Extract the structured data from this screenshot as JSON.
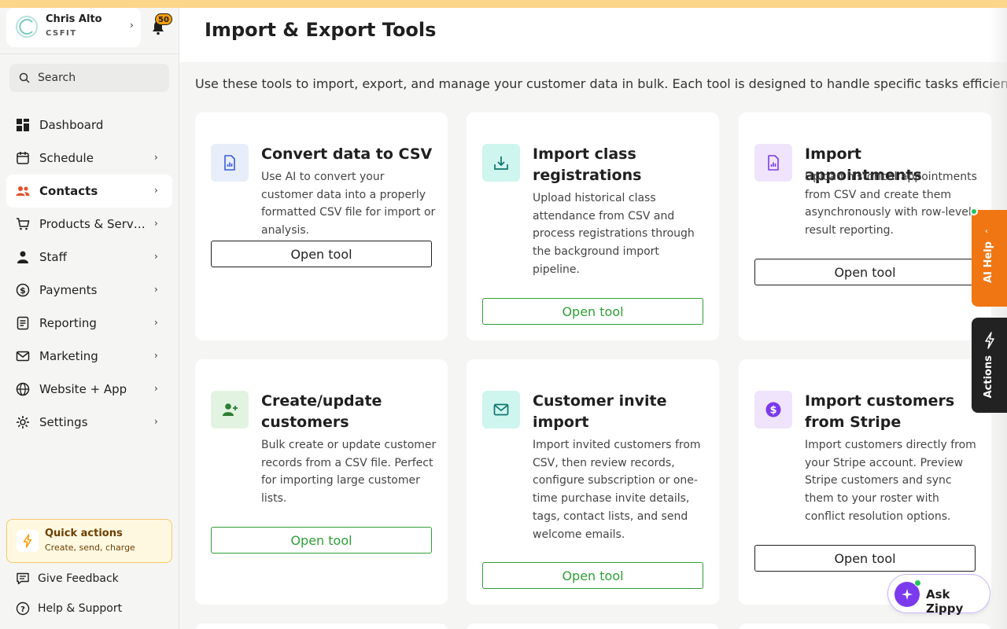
{
  "profile": {
    "name": "Chris Alto",
    "org": "CSFIT",
    "notifications": "50"
  },
  "search": {
    "placeholder": "Search"
  },
  "nav": [
    {
      "label": "Dashboard",
      "icon": "grid-icon",
      "chevron": false,
      "active": false
    },
    {
      "label": "Schedule",
      "icon": "calendar-icon",
      "chevron": true,
      "active": false
    },
    {
      "label": "Contacts",
      "icon": "users-icon",
      "chevron": true,
      "active": true
    },
    {
      "label": "Products & Servi...",
      "icon": "cart-icon",
      "chevron": true,
      "active": false
    },
    {
      "label": "Staff",
      "icon": "person-icon",
      "chevron": true,
      "active": false
    },
    {
      "label": "Payments",
      "icon": "dollar-icon",
      "chevron": true,
      "active": false
    },
    {
      "label": "Reporting",
      "icon": "report-icon",
      "chevron": true,
      "active": false
    },
    {
      "label": "Marketing",
      "icon": "mail-icon",
      "chevron": true,
      "active": false
    },
    {
      "label": "Website + App",
      "icon": "globe-icon",
      "chevron": true,
      "active": false
    },
    {
      "label": "Settings",
      "icon": "gear-icon",
      "chevron": true,
      "active": false
    }
  ],
  "quick_actions": {
    "title": "Quick actions",
    "subtitle": "Create, send, charge"
  },
  "footer": {
    "feedback": "Give Feedback",
    "help": "Help & Support"
  },
  "page": {
    "title": "Import & Export Tools",
    "intro": "Use these tools to import, export, and manage your customer data in bulk. Each tool is designed to handle specific tasks efficiently."
  },
  "cards": [
    {
      "title": "Convert data to CSV",
      "desc": "Use AI to convert your customer data into a properly formatted CSV file for import or analysis.",
      "button": "Open tool",
      "icon": "document-chart-icon"
    },
    {
      "title": "Import class registrations",
      "desc": "Upload historical class attendance from CSV and process registrations through the background import pipeline.",
      "button": "Open tool",
      "icon": "download-tray-icon"
    },
    {
      "title": "Import appointments",
      "desc": "Upload historical appointments from CSV and create them asynchronously with row-level result reporting.",
      "button": "Open tool",
      "icon": "document-chart-icon"
    },
    {
      "title": "Create/update customers",
      "desc": "Bulk create or update customer records from a CSV file. Perfect for importing large customer lists.",
      "button": "Open tool",
      "icon": "user-plus-icon"
    },
    {
      "title": "Customer invite import",
      "desc": "Import invited customers from CSV, then review records, configure subscription or one-time purchase invite details, tags, contact lists, and send welcome emails.",
      "button": "Open tool",
      "icon": "envelope-icon"
    },
    {
      "title": "Import customers from Stripe",
      "desc": "Import customers directly from your Stripe account. Preview Stripe customers and sync them to your roster with conflict resolution options.",
      "button": "Open tool",
      "icon": "dollar-circle-icon"
    }
  ],
  "side_tabs": {
    "ai_help": "AI Help",
    "actions": "Actions"
  },
  "zippy": {
    "label": "Ask Zippy"
  },
  "colors": {
    "accent_orange": "#f07613",
    "green": "#2e9e35",
    "purple": "#7c3aed",
    "banner": "#fcd68a"
  }
}
